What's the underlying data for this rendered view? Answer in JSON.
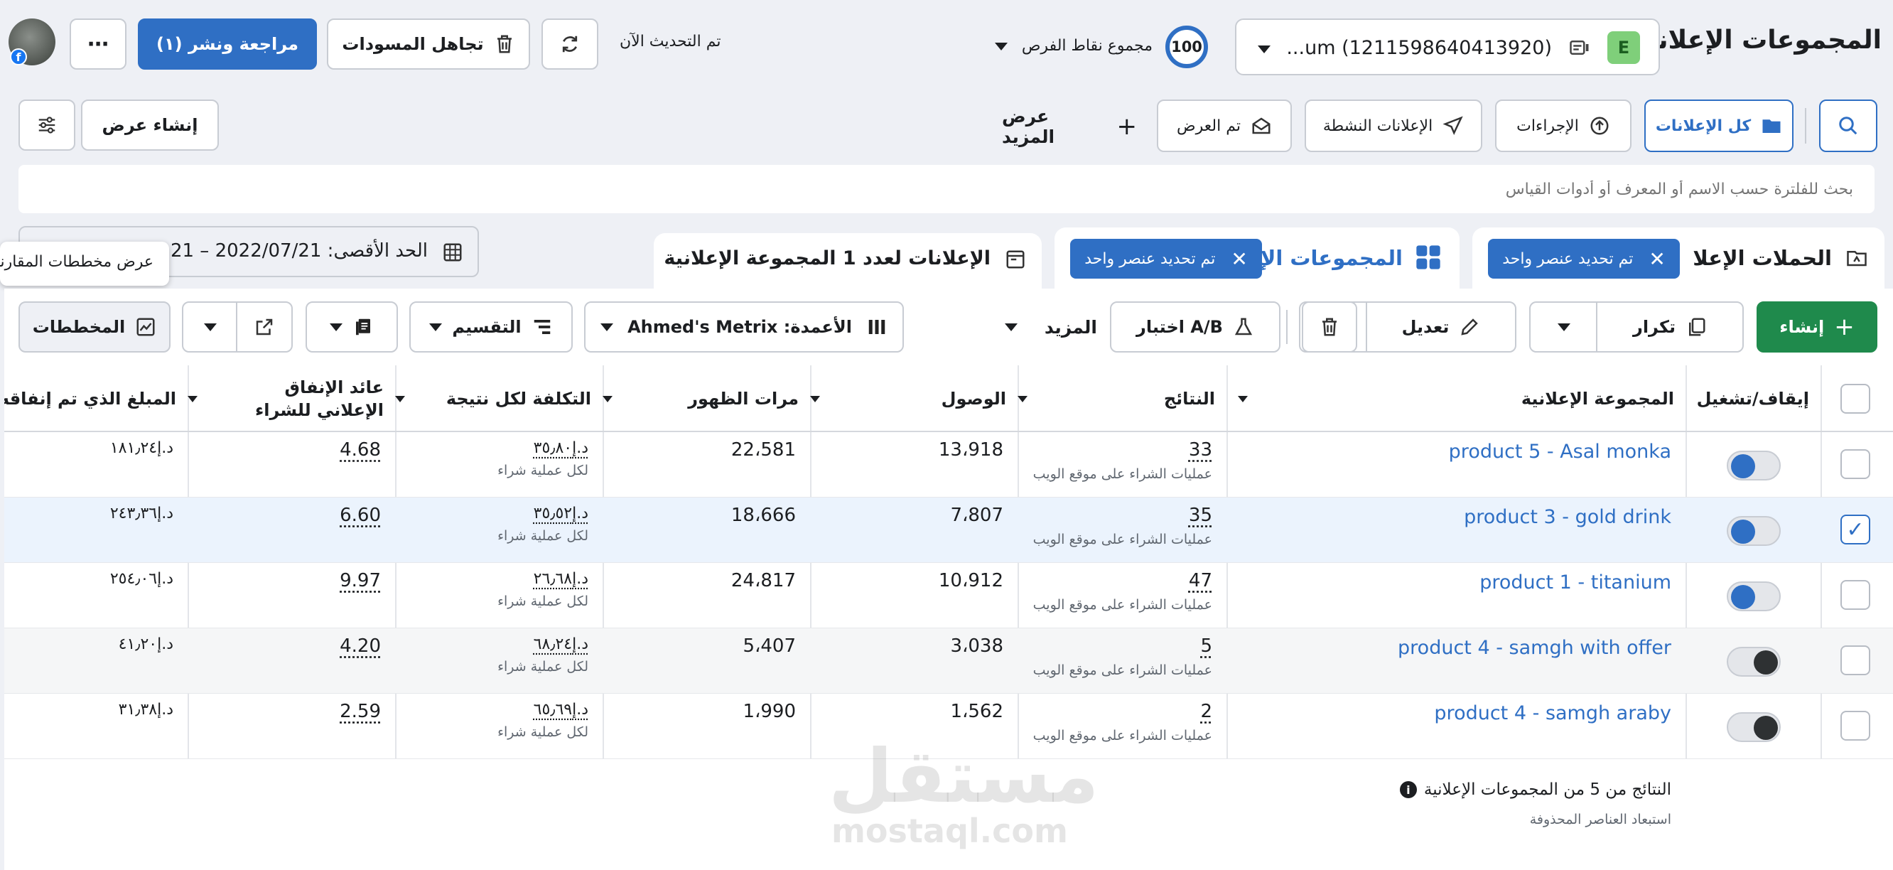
{
  "header": {
    "title": "المجموعات الإعلانية",
    "account_badge": "E",
    "account_name": "...um (1211598640413920)",
    "opportunity_score": "100",
    "opportunity_label": "مجموع نقاط الفرص",
    "updated_text": "تم التحديث الآن",
    "discard_label": "تجاهل المسودات",
    "review_publish_label": "مراجعة ونشر (١)"
  },
  "filters": {
    "all_ads": "كل الإعلانات",
    "actions": "الإجراءات",
    "active_ads": "الإعلانات النشطة",
    "shown": "تم العرض",
    "more": "عرض المزيد",
    "create_view": "إنشاء عرض",
    "search_placeholder": "بحث للفلترة حسب الاسم أو المعرف أو أدوات القياس"
  },
  "tabs": {
    "campaigns": "الحملات الإعلا",
    "campaigns_selected": "تم تحديد عنصر واحد",
    "adsets": "المجموعات الإ",
    "adsets_selected": "تم تحديد عنصر واحد",
    "ads": "الإعلانات لعدد 1 المجموعة الإعلانية",
    "date_range": "الحد الأقصى: 2022/07/21 – 21",
    "compare_tooltip": "عرض مخططات المقارنة"
  },
  "toolbar": {
    "create": "إنشاء",
    "duplicate": "تكرار",
    "edit": "تعديل",
    "ab_test": "اختبار A/B",
    "more": "المزيد",
    "columns": "الأعمدة: Ahmed's Metrix",
    "breakdown": "التقسيم",
    "charts": "المخططات"
  },
  "table": {
    "headers": {
      "toggle": "إيقاف/تشغيل",
      "name": "المجموعة الإعلانية",
      "results": "النتائج",
      "reach": "الوصول",
      "impressions": "مرات الظهور",
      "cost": "التكلفة لكل نتيجة",
      "roas": "عائد الإنفاق الإعلاني للشراء",
      "spent": "المبلغ الذي تم إنفاقه"
    },
    "rows": [
      {
        "name": "product 5 - Asal monka",
        "results": "33",
        "results_sub": "عمليات الشراء على موقع الويب",
        "reach": "13،918",
        "impressions": "22،581",
        "cost": "د.إ‏٣٥٫٨٠",
        "cost_sub": "لكل عملية شراء",
        "roas": "4.68",
        "spent": "د.إ‏١٨١٫٢٤"
      },
      {
        "name": "product 3 - gold drink",
        "results": "35",
        "results_sub": "عمليات الشراء على موقع الويب",
        "reach": "7،807",
        "impressions": "18،666",
        "cost": "د.إ‏٣٥٫٥٢",
        "cost_sub": "لكل عملية شراء",
        "roas": "6.60",
        "spent": "د.إ‏٢٤٣٫٣٦"
      },
      {
        "name": "product 1 - titanium",
        "results": "47",
        "results_sub": "عمليات الشراء على موقع الويب",
        "reach": "10،912",
        "impressions": "24،817",
        "cost": "د.إ‏٢٦٫٦٨",
        "cost_sub": "لكل عملية شراء",
        "roas": "9.97",
        "spent": "د.إ‏٢٥٤٫٠٦"
      },
      {
        "name": "product 4 - samgh with offer",
        "results": "5",
        "results_sub": "عمليات الشراء على موقع الويب",
        "reach": "3،038",
        "impressions": "5،407",
        "cost": "د.إ‏٦٨٫٢٤",
        "cost_sub": "لكل عملية شراء",
        "roas": "4.20",
        "spent": "د.إ‏٤١٫٢٠"
      },
      {
        "name": "product 4 - samgh araby",
        "results": "2",
        "results_sub": "عمليات الشراء على موقع الويب",
        "reach": "1،562",
        "impressions": "1،990",
        "cost": "د.إ‏٦٥٫٦٩",
        "cost_sub": "لكل عملية شراء",
        "roas": "2.59",
        "spent": "د.إ‏٣١٫٣٨"
      }
    ],
    "footer_title": "النتائج من 5 من المجموعات الإعلانية",
    "footer_sub": "استبعاد العناصر المحذوفة"
  },
  "watermark": {
    "arabic": "مستقل",
    "latin": "mostaql.com"
  }
}
